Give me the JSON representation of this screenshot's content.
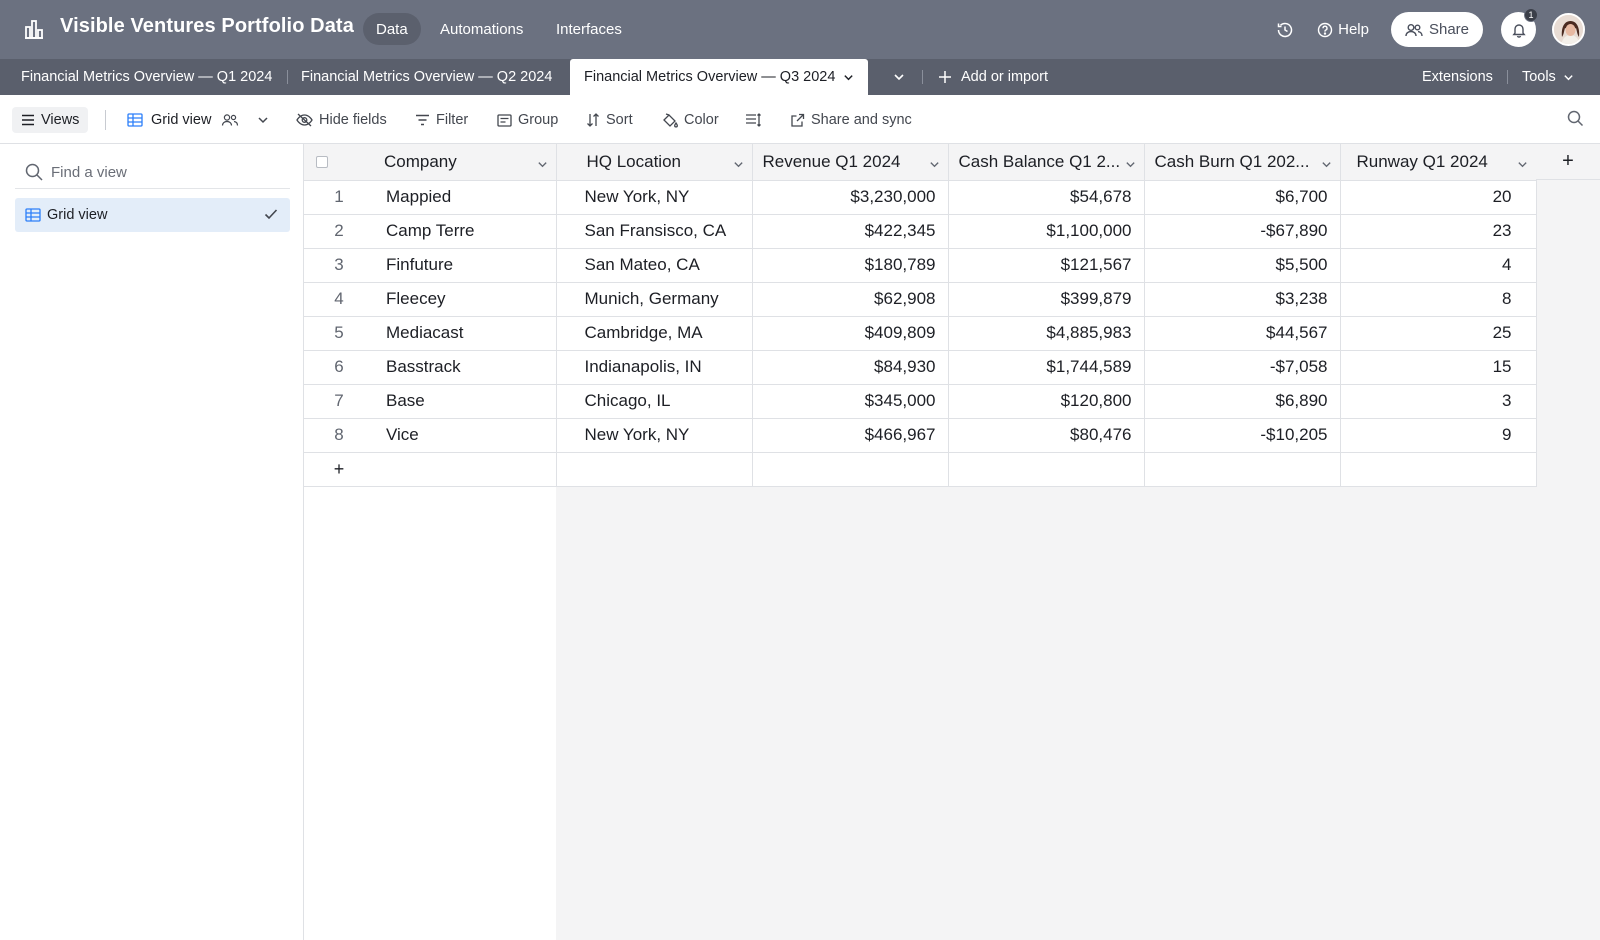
{
  "header": {
    "base_title": "Visible Ventures Portfolio Data",
    "nav": [
      "Data",
      "Automations",
      "Interfaces"
    ],
    "help_label": "Help",
    "share_label": "Share",
    "notification_count": "1"
  },
  "tabs": {
    "items": [
      "Financial Metrics Overview — Q1 2024",
      "Financial Metrics Overview — Q2 2024",
      "Financial Metrics Overview — Q3 2024"
    ],
    "add_label": "Add or import",
    "extensions_label": "Extensions",
    "tools_label": "Tools"
  },
  "toolbar": {
    "views_label": "Views",
    "view_name": "Grid view",
    "hide_fields_label": "Hide fields",
    "filter_label": "Filter",
    "group_label": "Group",
    "sort_label": "Sort",
    "color_label": "Color",
    "share_sync_label": "Share and sync"
  },
  "sidebar": {
    "find_placeholder": "Find a view",
    "views": [
      "Grid view"
    ]
  },
  "table": {
    "columns": [
      "Company",
      "HQ Location",
      "Revenue Q1 2024",
      "Cash Balance Q1 2...",
      "Cash Burn Q1 202...",
      "Runway Q1 2024"
    ],
    "rows": [
      {
        "n": "1",
        "company": "Mappied",
        "hq": "New York, NY",
        "revenue": "$3,230,000",
        "cash": "$54,678",
        "burn": "$6,700",
        "runway": "20"
      },
      {
        "n": "2",
        "company": "Camp Terre",
        "hq": "San Fransisco, CA",
        "revenue": "$422,345",
        "cash": "$1,100,000",
        "burn": "-$67,890",
        "runway": "23"
      },
      {
        "n": "3",
        "company": "Finfuture",
        "hq": "San Mateo, CA",
        "revenue": "$180,789",
        "cash": "$121,567",
        "burn": "$5,500",
        "runway": "4"
      },
      {
        "n": "4",
        "company": "Fleecey",
        "hq": "Munich, Germany",
        "revenue": "$62,908",
        "cash": "$399,879",
        "burn": "$3,238",
        "runway": "8"
      },
      {
        "n": "5",
        "company": "Mediacast",
        "hq": "Cambridge, MA",
        "revenue": "$409,809",
        "cash": "$4,885,983",
        "burn": "$44,567",
        "runway": "25"
      },
      {
        "n": "6",
        "company": "Basstrack",
        "hq": "Indianapolis, IN",
        "revenue": "$84,930",
        "cash": "$1,744,589",
        "burn": "-$7,058",
        "runway": "15"
      },
      {
        "n": "7",
        "company": "Base",
        "hq": "Chicago, IL",
        "revenue": "$345,000",
        "cash": "$120,800",
        "burn": "$6,890",
        "runway": "3"
      },
      {
        "n": "8",
        "company": "Vice",
        "hq": "New York, NY",
        "revenue": "$466,967",
        "cash": "$80,476",
        "burn": "-$10,205",
        "runway": "9"
      }
    ],
    "add_row_label": "+",
    "add_column_label": "+"
  },
  "colors": {
    "topbar": "#6b7180",
    "tabbar": "#5a5f6c",
    "selected_view": "#e3edf9",
    "grid_border": "#dfe1e5"
  }
}
